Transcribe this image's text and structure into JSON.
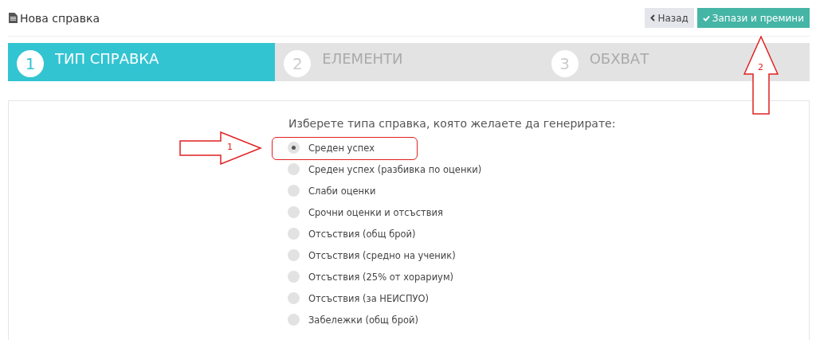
{
  "page": {
    "title": "Нова справка"
  },
  "buttons": [
    {
      "kind": "back",
      "label": "Назад"
    },
    {
      "kind": "save",
      "label": "Запази и премини"
    }
  ],
  "steps": [
    {
      "number": "1",
      "label": "ТИП СПРАВКА",
      "selected": true
    },
    {
      "number": "2",
      "label": "ЕЛЕМЕНТИ",
      "selected": false
    },
    {
      "number": "3",
      "label": "ОБХВАТ",
      "selected": false
    }
  ],
  "prompt": "Изберете типа справка, която желаете да генерирате:",
  "options": [
    {
      "label": "Среден успех",
      "selected": true
    },
    {
      "label": "Среден успех (разбивка по оценки)",
      "selected": false
    },
    {
      "label": "Слаби оценки",
      "selected": false
    },
    {
      "label": "Срочни оценки и отсъствия",
      "selected": false
    },
    {
      "label": "Отсъствия (общ брой)",
      "selected": false
    },
    {
      "label": "Отсъствия (средно на ученик)",
      "selected": false
    },
    {
      "label": "Отсъствия (25% от хорариум)",
      "selected": false
    },
    {
      "label": "Отсъствия (за НЕИСПУО)",
      "selected": false
    },
    {
      "label": "Забележки (общ брой)",
      "selected": false
    }
  ],
  "annotations": [
    {
      "kind": "right",
      "label": "1"
    },
    {
      "kind": "up",
      "label": "2"
    }
  ]
}
